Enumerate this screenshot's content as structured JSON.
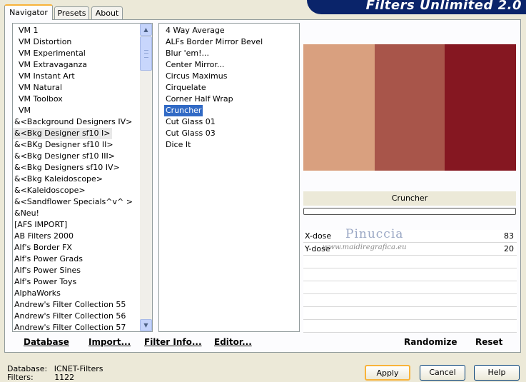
{
  "tabs": [
    "Navigator",
    "Presets",
    "About"
  ],
  "banner": "Filters Unlimited 2.0",
  "categories": [
    "VM 1",
    "VM Distortion",
    "VM Experimental",
    "VM Extravaganza",
    "VM Instant Art",
    "VM Natural",
    "VM Toolbox",
    "VM",
    "&<Background Designers IV>",
    "&<Bkg Designer sf10 I>",
    "&<BKg Designer sf10 II>",
    "&<Bkg Designer sf10 III>",
    "&<Bkg Designers sf10 IV>",
    "&<Bkg Kaleidoscope>",
    "&<Kaleidoscope>",
    "&<Sandflower Specials^v^ >",
    "&Neu!",
    "[AFS IMPORT]",
    "AB Filters 2000",
    "Alf's Border FX",
    "Alf's Power Grads",
    "Alf's Power Sines",
    "Alf's Power Toys",
    "AlphaWorks",
    "Andrew's Filter Collection 55",
    "Andrew's Filter Collection 56",
    "Andrew's Filter Collection 57"
  ],
  "selected_category": "&<Bkg Designer sf10 I>",
  "filters": [
    "4 Way Average",
    "ALFs Border Mirror Bevel",
    "Blur 'em!...",
    "Center Mirror...",
    "Circus Maximus",
    "Cirquelate",
    "Corner Half Wrap",
    "Cruncher",
    "Cut Glass 01",
    "Cut Glass 03",
    "Dice It"
  ],
  "selected_filter": "Cruncher",
  "preview_colors": [
    "#d9a07f",
    "#a8554a",
    "#851721"
  ],
  "filter_name_label": "Cruncher",
  "params": [
    {
      "name": "X-dose",
      "value": "83"
    },
    {
      "name": "Y-dose",
      "value": "20"
    }
  ],
  "watermark": {
    "line1": "Pinuccia",
    "line2": "www.maidiregrafica.eu"
  },
  "toolbar": {
    "database": "Database",
    "import": "Import...",
    "filter_info": "Filter Info...",
    "editor": "Editor...",
    "randomize": "Randomize",
    "reset": "Reset"
  },
  "status": {
    "database_label": "Database:",
    "database_value": "ICNET-Filters",
    "filters_label": "Filters:",
    "filters_value": "1122"
  },
  "buttons": {
    "apply": "Apply",
    "cancel": "Cancel",
    "help": "Help"
  }
}
